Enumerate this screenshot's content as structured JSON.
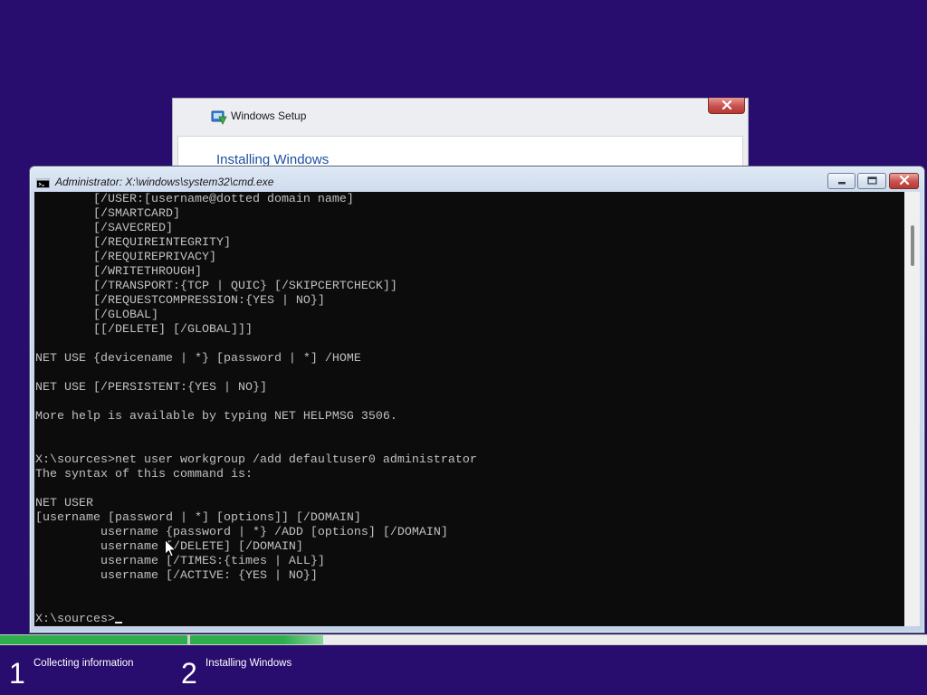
{
  "colors": {
    "desktop_background": "#280c6e",
    "console_background": "#0c0c0c",
    "console_text": "#c0c0c0",
    "progress_green": "#2fae4d",
    "close_button": "#c75050",
    "setup_heading": "#1c4fa3"
  },
  "setup_window": {
    "title": "Windows Setup",
    "heading": "Installing Windows",
    "icons": [
      "windows-setup-icon",
      "close-icon"
    ]
  },
  "cmd_window": {
    "title": "Administrator: X:\\windows\\system32\\cmd.exe",
    "icons": [
      "cmd-icon",
      "minimize-icon",
      "maximize-icon",
      "close-icon"
    ],
    "lines": [
      "        [/USER:[username@dotted domain name]",
      "        [/SMARTCARD]",
      "        [/SAVECRED]",
      "        [/REQUIREINTEGRITY]",
      "        [/REQUIREPRIVACY]",
      "        [/WRITETHROUGH]",
      "        [/TRANSPORT:{TCP | QUIC} [/SKIPCERTCHECK]]",
      "        [/REQUESTCOMPRESSION:{YES | NO}]",
      "        [/GLOBAL]",
      "        [[/DELETE] [/GLOBAL]]]",
      "",
      "NET USE {devicename | *} [password | *] /HOME",
      "",
      "NET USE [/PERSISTENT:{YES | NO}]",
      "",
      "More help is available by typing NET HELPMSG 3506.",
      "",
      "",
      "X:\\sources>net user workgroup /add defaultuser0 administrator",
      "The syntax of this command is:",
      "",
      "NET USER",
      "[username [password | *] [options]] [/DOMAIN]",
      "         username {password | *} /ADD [options] [/DOMAIN]",
      "         username [/DELETE] [/DOMAIN]",
      "         username [/TIMES:{times | ALL}]",
      "         username [/ACTIVE: {YES | NO}]",
      "",
      ""
    ],
    "prompt": "X:\\sources>",
    "scrollbar": {
      "scroll_position": 0.05,
      "visible_fraction": 0.1
    }
  },
  "setup_progress": {
    "steps": [
      {
        "number": "1",
        "label": "Collecting information",
        "progress": 1.0
      },
      {
        "number": "2",
        "label": "Installing Windows",
        "progress": 0.18
      }
    ]
  },
  "pointer": "mouse-pointer-icon"
}
